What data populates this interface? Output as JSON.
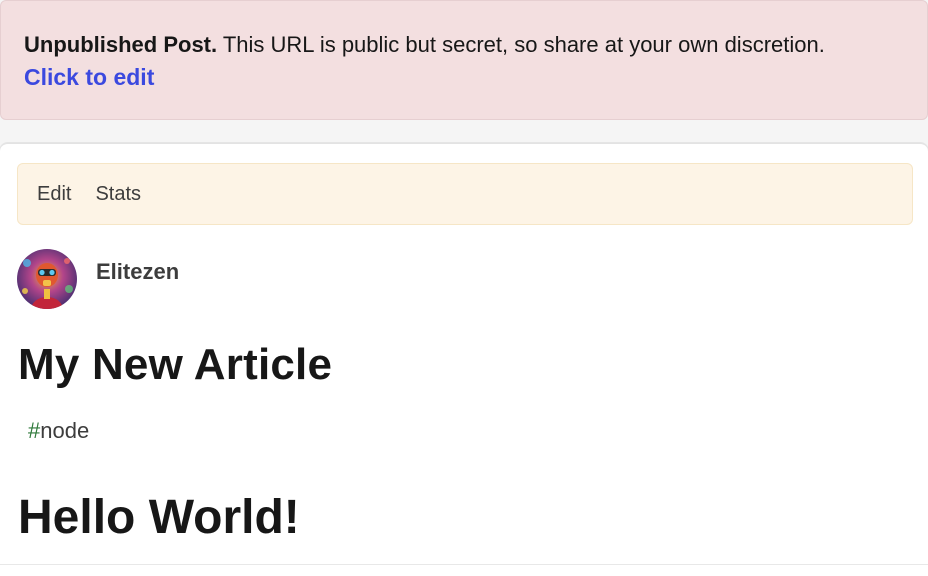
{
  "notice": {
    "strong": "Unpublished Post.",
    "message": " This URL is public but secret, so share at your own discretion.",
    "edit_link": "Click to edit"
  },
  "actions": {
    "edit": "Edit",
    "stats": "Stats"
  },
  "author": {
    "name": "Elitezen",
    "avatar_icon": "avatar-image"
  },
  "article": {
    "title": "My New Article",
    "tag_hash": "#",
    "tag": "node",
    "body_heading": "Hello World!"
  },
  "colors": {
    "notice_bg": "#f3dfe0",
    "link": "#3b49df",
    "actions_bg": "#fdf4e6",
    "tag_hash": "#2f7a3b"
  }
}
